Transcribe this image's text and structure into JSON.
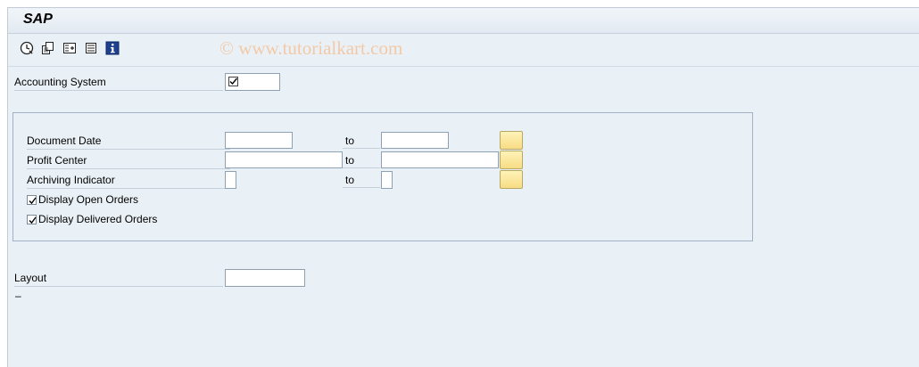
{
  "window": {
    "title": "SAP"
  },
  "watermark": "© www.tutorialkart.com",
  "toolbar": {
    "buttons": [
      {
        "icon": "execute-icon"
      },
      {
        "icon": "variants-icon"
      },
      {
        "icon": "selection-options-icon"
      },
      {
        "icon": "delete-selection-icon"
      },
      {
        "icon": "info-icon"
      }
    ]
  },
  "fields": {
    "accounting_system": {
      "label": "Accounting System"
    },
    "document_date": {
      "label": "Document Date",
      "to": "to"
    },
    "profit_center": {
      "label": "Profit Center",
      "to": "to"
    },
    "archiving_indicator": {
      "label": "Archiving Indicator",
      "to": "to"
    },
    "open_orders": {
      "label": "Display Open Orders",
      "checked": true
    },
    "delivered_orders": {
      "label": "Display Delivered Orders",
      "checked": true
    },
    "layout": {
      "label": "Layout"
    }
  },
  "status_text": "–",
  "colors": {
    "background": "#eaf1f6",
    "multi_select_button": "#f7dc84",
    "watermark": "#f2c9a7"
  }
}
